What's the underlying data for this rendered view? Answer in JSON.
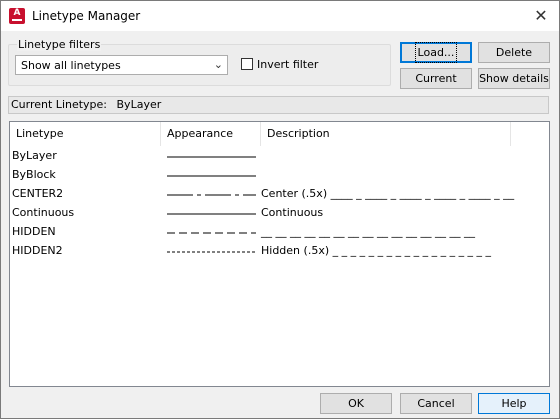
{
  "window": {
    "title": "Linetype Manager",
    "close_glyph": "✕",
    "app_icon_letter": "A"
  },
  "filters": {
    "group_label": "Linetype filters",
    "selected": "Show all linetypes",
    "invert_label": "Invert filter",
    "invert_checked": false
  },
  "buttons": {
    "load": "Load...",
    "delete": "Delete",
    "current": "Current",
    "show_details": "Show details",
    "ok": "OK",
    "cancel": "Cancel",
    "help": "Help"
  },
  "current_linetype": {
    "label": "Current Linetype:",
    "value": "ByLayer"
  },
  "list": {
    "columns": [
      "Linetype",
      "Appearance",
      "Description"
    ],
    "rows": [
      {
        "name": "ByLayer",
        "pattern": "solid",
        "description": ""
      },
      {
        "name": "ByBlock",
        "pattern": "solid",
        "description": ""
      },
      {
        "name": "CENTER2",
        "pattern": "center",
        "description": "Center (.5x) ____ _ ____ _ ____ _ ____ _ ____ _ __"
      },
      {
        "name": "Continuous",
        "pattern": "solid",
        "description": "Continuous"
      },
      {
        "name": "HIDDEN",
        "pattern": "hidden",
        "description": "__ __ __ __ __ __ __ __ __ __ __ __ __ __ __"
      },
      {
        "name": "HIDDEN2",
        "pattern": "hidden2",
        "description": "Hidden (.5x) _ _ _ _ _ _ _ _ _ _ _ _ _ _ _ _ _ _"
      }
    ]
  }
}
